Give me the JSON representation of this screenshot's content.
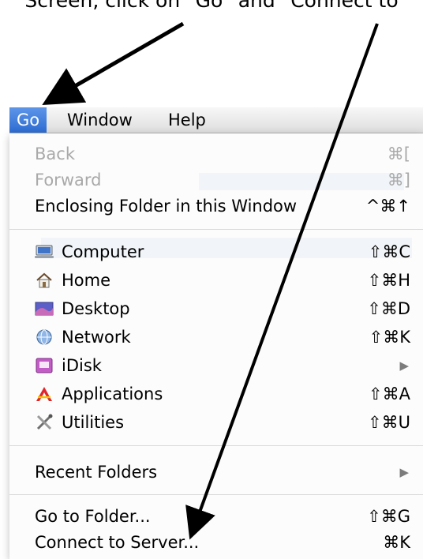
{
  "instruction": "Screen, click on \"Go\" and \"Connect to",
  "menubar": {
    "items": [
      {
        "label": "Go",
        "active": true
      },
      {
        "label": "Window",
        "active": false
      },
      {
        "label": "Help",
        "active": false
      }
    ]
  },
  "menu": {
    "back": {
      "label": "Back",
      "shortcut": "⌘[",
      "enabled": false
    },
    "forward": {
      "label": "Forward",
      "shortcut": "⌘]",
      "enabled": false
    },
    "enclosing": {
      "label": "Enclosing Folder in this Window",
      "shortcut": "^⌘↑"
    },
    "computer": {
      "label": "Computer",
      "shortcut": "⇧⌘C",
      "icon": "computer-icon"
    },
    "home": {
      "label": "Home",
      "shortcut": "⇧⌘H",
      "icon": "home-icon"
    },
    "desktop": {
      "label": "Desktop",
      "shortcut": "⇧⌘D",
      "icon": "desktop-icon"
    },
    "network": {
      "label": "Network",
      "shortcut": "⇧⌘K",
      "icon": "network-icon"
    },
    "idisk": {
      "label": "iDisk",
      "submenu": true,
      "icon": "idisk-icon"
    },
    "applications": {
      "label": "Applications",
      "shortcut": "⇧⌘A",
      "icon": "applications-icon"
    },
    "utilities": {
      "label": "Utilities",
      "shortcut": "⇧⌘U",
      "icon": "utilities-icon"
    },
    "recent": {
      "label": "Recent Folders",
      "submenu": true
    },
    "gotofolder": {
      "label": "Go to Folder...",
      "shortcut": "⇧⌘G"
    },
    "connect": {
      "label": "Connect to Server...",
      "shortcut": "⌘K"
    }
  },
  "colors": {
    "menu_highlight": "#3a78dc",
    "arrow": "#000000",
    "disabled_text": "#a9a9a9"
  }
}
